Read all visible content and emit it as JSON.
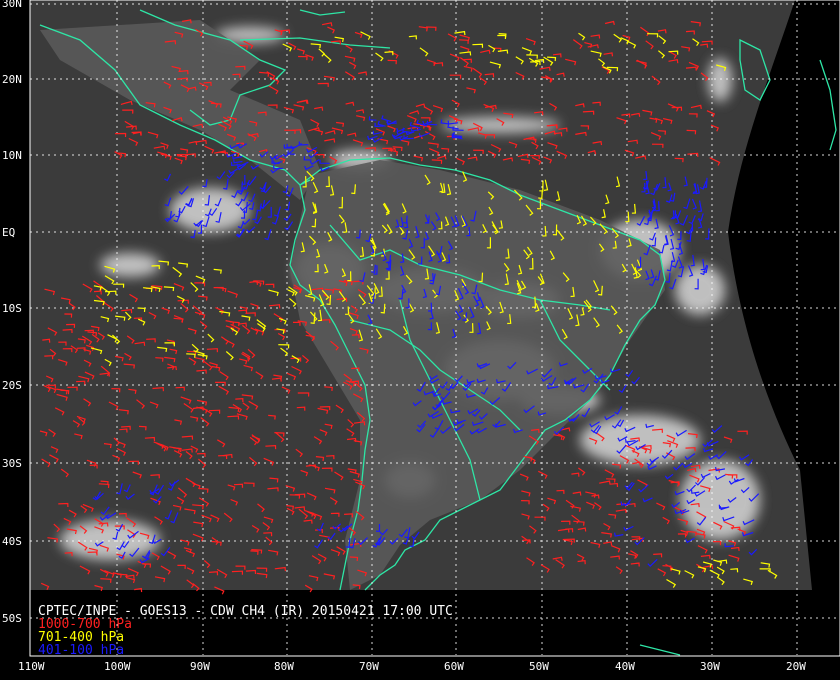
{
  "title": "CPTEC/INPE - GOES13 - CDW CH4 (IR) 20150421 17:00 UTC",
  "legend": [
    {
      "label": "1000-700 hPa",
      "color": "#ff2020"
    },
    {
      "label": "701-400 hPa",
      "color": "#ffff00"
    },
    {
      "label": "401-100 hPa",
      "color": "#1a1aff"
    }
  ],
  "lat_labels": [
    "30N",
    "20N",
    "10N",
    "EQ",
    "10S",
    "20S",
    "30S",
    "40S",
    "50S"
  ],
  "lon_labels": [
    "110W",
    "100W",
    "90W",
    "80W",
    "70W",
    "60W",
    "50W",
    "40W",
    "30W",
    "20W"
  ],
  "colors": {
    "coastline": "#2ee6a6",
    "grid": "#ffffff",
    "space": "#000000",
    "satellite_background": "#3a3a3a",
    "land": "#7f7f7f"
  }
}
